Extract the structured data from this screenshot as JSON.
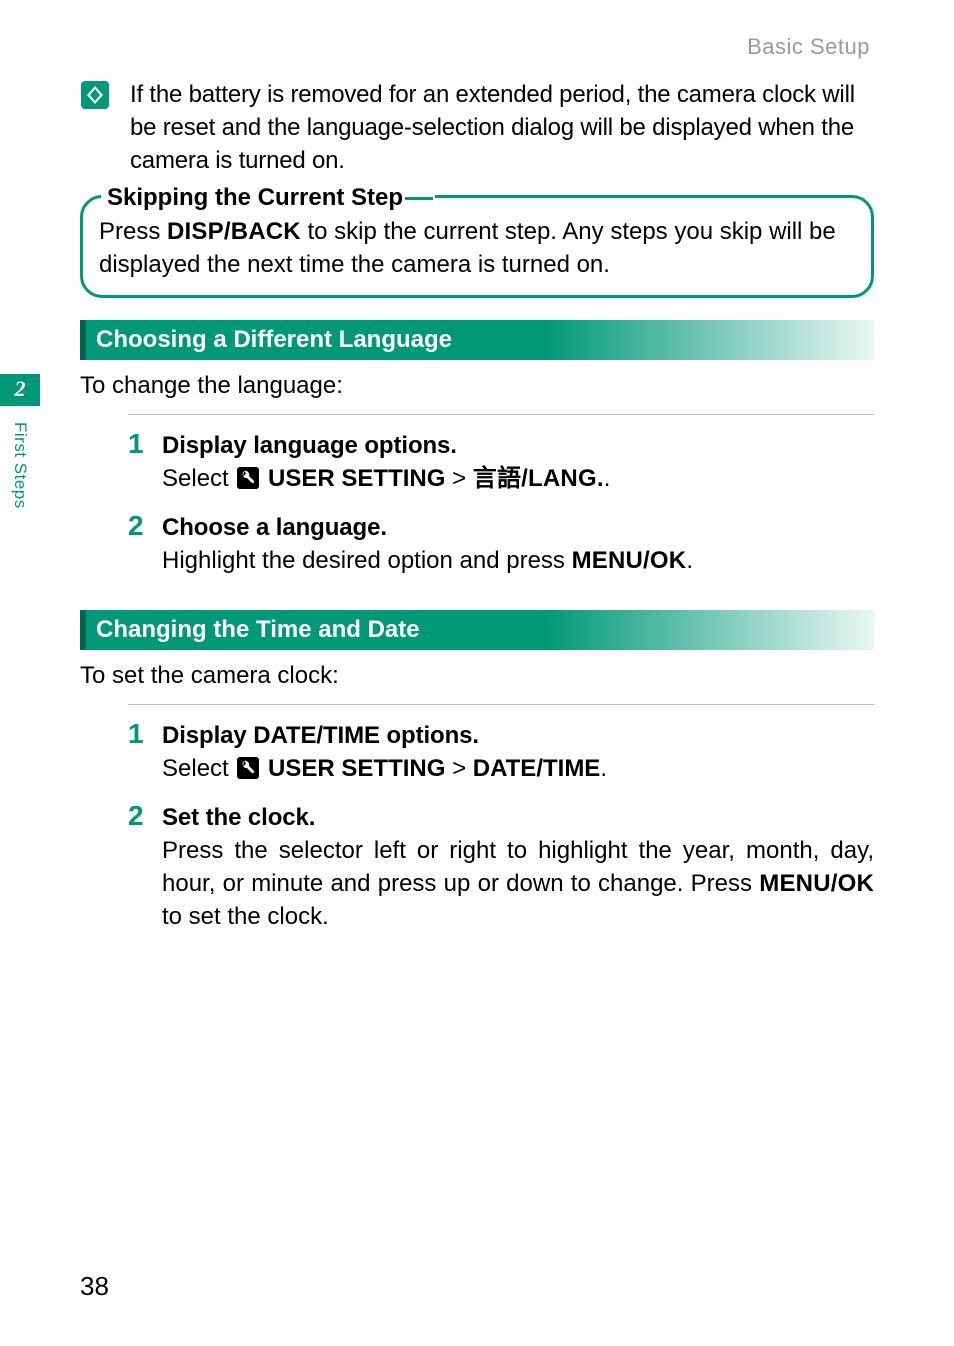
{
  "header": {
    "breadcrumb": "Basic Setup"
  },
  "side_tab": {
    "chapter_number": "2",
    "chapter_label": "First Steps"
  },
  "note": {
    "text": "If the battery is removed for an extended period, the camera clock will be reset and the language-selection dialog will be displayed when the camera is turned on."
  },
  "callout": {
    "legend": "Skipping the Current Step",
    "body_a": "Press ",
    "body_button": "DISP/BACK",
    "body_b": " to skip the current step.  Any steps you skip will be displayed the next time the camera is turned on."
  },
  "section_lang": {
    "bar": "Choosing a Different Language",
    "intro": "To change the language:",
    "steps": [
      {
        "num": "1",
        "title": "Display language options.",
        "desc_a": "Select ",
        "menu": "USER SETTING",
        "gt": " > ",
        "lang_label": "言語/LANG.",
        "trail": "."
      },
      {
        "num": "2",
        "title": "Choose a language.",
        "desc_a": "Highlight the desired option and press ",
        "btn": "MENU/OK",
        "trail": "."
      }
    ]
  },
  "section_time": {
    "bar": "Changing the Time and Date",
    "intro": "To set the camera clock:",
    "steps": [
      {
        "num": "1",
        "title": "Display DATE/TIME options.",
        "desc_a": "Select ",
        "menu": "USER SETTING",
        "gt": " > ",
        "item": "DATE/TIME",
        "trail": "."
      },
      {
        "num": "2",
        "title": "Set the clock.",
        "desc_a": "Press the selector left or right to highlight the year, month, day, hour, or minute and press up or down to change.  Press ",
        "btn": "MENU/OK",
        "desc_b": " to set the clock."
      }
    ]
  },
  "page_number": "38"
}
